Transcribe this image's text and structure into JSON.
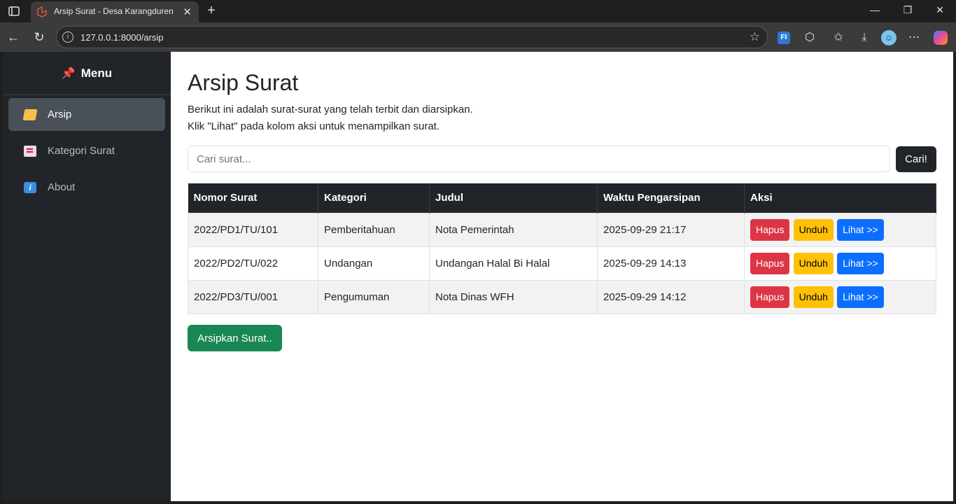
{
  "browser": {
    "tab_title": "Arsip Surat - Desa Karangduren",
    "url": "127.0.0.1:8000/arsip",
    "ext_badge": "FI"
  },
  "sidebar": {
    "title": "Menu",
    "items": [
      {
        "label": "Arsip",
        "icon": "folder-icon",
        "active": true
      },
      {
        "label": "Kategori Surat",
        "icon": "note-icon",
        "active": false
      },
      {
        "label": "About",
        "icon": "info-icon",
        "active": false
      }
    ]
  },
  "main": {
    "title": "Arsip Surat",
    "desc1": "Berikut ini adalah surat-surat yang telah terbit dan diarsipkan.",
    "desc2": "Klik \"Lihat\" pada kolom aksi untuk menampilkan surat.",
    "search_placeholder": "Cari surat...",
    "search_button": "Cari!",
    "columns": [
      "Nomor Surat",
      "Kategori",
      "Judul",
      "Waktu Pengarsipan",
      "Aksi"
    ],
    "rows": [
      {
        "nomor": "2022/PD1/TU/101",
        "kategori": "Pemberitahuan",
        "judul": "Nota Pemerintah",
        "waktu": "2025-09-29 21:17"
      },
      {
        "nomor": "2022/PD2/TU/022",
        "kategori": "Undangan",
        "judul": "Undangan Halal Bi Halal",
        "waktu": "2025-09-29 14:13"
      },
      {
        "nomor": "2022/PD3/TU/001",
        "kategori": "Pengumuman",
        "judul": "Nota Dinas WFH",
        "waktu": "2025-09-29 14:12"
      }
    ],
    "actions": {
      "delete": "Hapus",
      "download": "Unduh",
      "view": "Lihat >>"
    },
    "archive_button": "Arsipkan Surat.."
  },
  "colors": {
    "sidebar_bg": "#212529",
    "danger": "#dc3545",
    "warning": "#ffc107",
    "primary": "#0d6efd",
    "success": "#198754"
  }
}
